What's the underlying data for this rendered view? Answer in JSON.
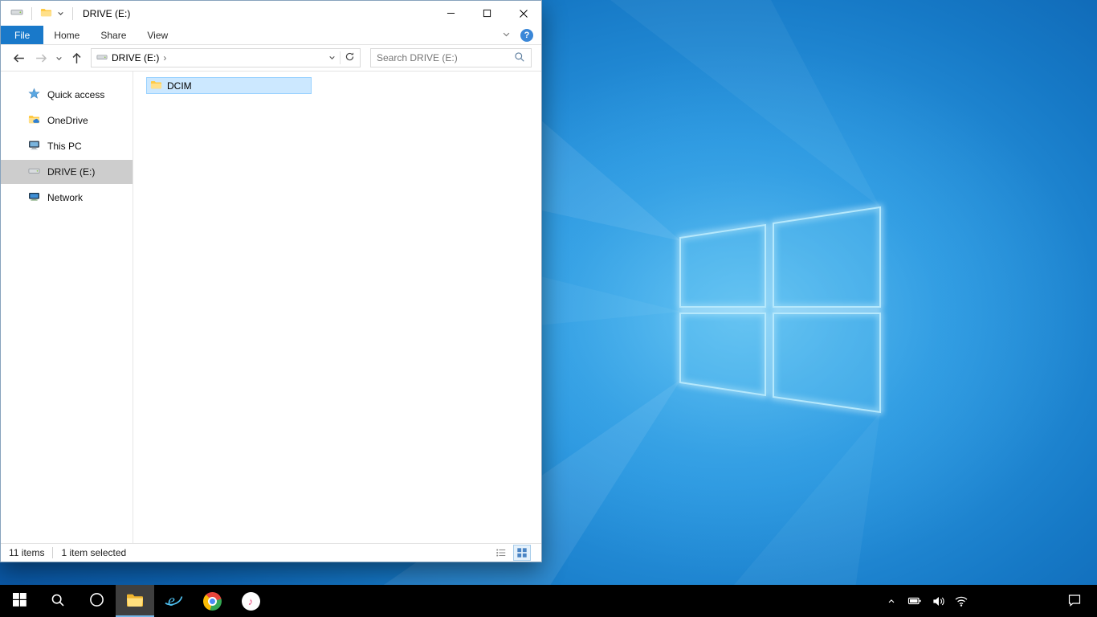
{
  "colors": {
    "accent": "#1979ca",
    "file_tab": "#1979ca",
    "selection_fill": "#cce8ff",
    "selection_border": "#99d1ff",
    "sidebar_selected": "#cdcdcd",
    "taskbar_bg": "#000000",
    "taskbar_active_underline": "#75b6e8",
    "wallpaper_center": "#47b1ee",
    "wallpaper_edge": "#0a57a4"
  },
  "icons": {
    "minimize": "—",
    "maximize": "▢",
    "close": "✕",
    "back": "←",
    "forward": "→",
    "up": "↑",
    "dropdown": "⌄",
    "refresh": "⟳",
    "search": "magnifier"
  },
  "explorer": {
    "titlebar": {
      "title": "DRIVE (E:)"
    },
    "ribbon": {
      "tabs": [
        {
          "label": "File",
          "active": true
        },
        {
          "label": "Home",
          "active": false
        },
        {
          "label": "Share",
          "active": false
        },
        {
          "label": "View",
          "active": false
        }
      ],
      "help_label": "?"
    },
    "navbar": {
      "breadcrumb": {
        "location": "DRIVE (E:)",
        "separator": "›"
      },
      "search_placeholder": "Search DRIVE (E:)"
    },
    "sidebar": {
      "items": [
        {
          "label": "Quick access",
          "icon": "star-icon",
          "selected": false
        },
        {
          "label": "OneDrive",
          "icon": "onedrive-icon",
          "selected": false
        },
        {
          "label": "This PC",
          "icon": "this-pc-icon",
          "selected": false
        },
        {
          "label": "DRIVE (E:)",
          "icon": "drive-icon",
          "selected": true
        },
        {
          "label": "Network",
          "icon": "network-icon",
          "selected": false
        }
      ]
    },
    "files": [
      {
        "name": "DCIM",
        "type": "folder",
        "selected": true
      }
    ],
    "statusbar": {
      "items_count": "11 items",
      "selection_count": "1 item selected"
    }
  },
  "taskbar": {
    "buttons": [
      {
        "name": "start",
        "icon": "windows-logo-icon"
      },
      {
        "name": "search",
        "icon": "search-icon"
      },
      {
        "name": "cortana",
        "icon": "cortana-icon"
      },
      {
        "name": "file-explorer",
        "icon": "folder-icon",
        "active": true
      },
      {
        "name": "internet-explorer",
        "icon": "ie-icon",
        "glyph": "e"
      },
      {
        "name": "chrome",
        "icon": "chrome-icon"
      },
      {
        "name": "itunes",
        "icon": "music-note-icon",
        "glyph": "♪"
      }
    ],
    "tray": {
      "icons": [
        "hidden-icons-chevron",
        "battery",
        "volume",
        "wifi"
      ]
    },
    "action_center": {
      "icon": "action-center-icon"
    }
  }
}
